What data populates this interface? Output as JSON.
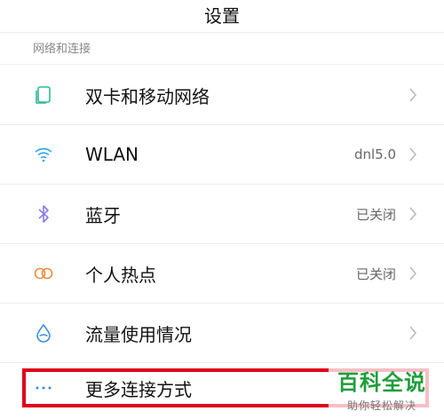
{
  "header": {
    "title": "设置"
  },
  "section": {
    "label": "网络和连接"
  },
  "rows": [
    {
      "label": "双卡和移动网络",
      "value": "",
      "icon": "sim-card-icon"
    },
    {
      "label": "WLAN",
      "value": "dnl5.0",
      "icon": "wifi-icon"
    },
    {
      "label": "蓝牙",
      "value": "已关闭",
      "icon": "bluetooth-icon"
    },
    {
      "label": "个人热点",
      "value": "已关闭",
      "icon": "hotspot-icon"
    },
    {
      "label": "流量使用情况",
      "value": "",
      "icon": "data-usage-icon"
    },
    {
      "label": "更多连接方式",
      "value": "",
      "icon": "more-dots-icon"
    }
  ],
  "watermark": {
    "main": "百科全说",
    "sub": "助你轻松解决"
  },
  "colors": {
    "highlight": "#e0001a",
    "watermark_green": "#1e9e3a",
    "sim_icon": "#2fb89a",
    "wifi_icon": "#3aa7e8",
    "bluetooth_icon": "#8a7be8",
    "hotspot_icon": "#f08a3c",
    "data_icon": "#3a8fd8",
    "more_icon": "#3a8fd8"
  }
}
